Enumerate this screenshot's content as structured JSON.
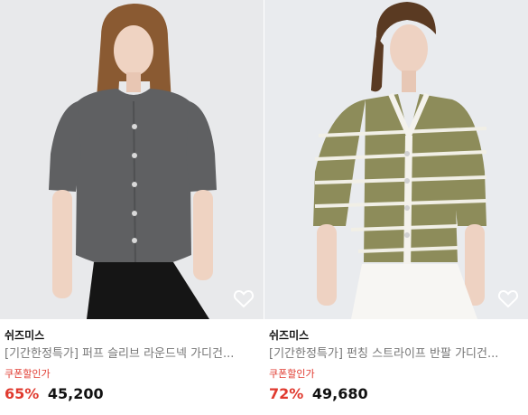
{
  "products": [
    {
      "brand": "쉬즈미스",
      "title": "[기간한정특가] 퍼프 슬리브 라운드넥 가디건...",
      "coupon": "쿠폰할인가",
      "discount": "65%",
      "price": "45,200",
      "wishlist_icon": "heart-outline-icon",
      "garment_color": "#5f6062"
    },
    {
      "brand": "쉬즈미스",
      "title": "[기간한정특가] 펀칭 스트라이프 반팔 가디건...",
      "coupon": "쿠폰할인가",
      "discount": "72%",
      "price": "49,680",
      "wishlist_icon": "heart-outline-icon",
      "garment_color": "#8d8c5a"
    }
  ],
  "colors": {
    "sale_red": "#e03a2f",
    "text_dark": "#111111",
    "text_muted": "#777777"
  }
}
